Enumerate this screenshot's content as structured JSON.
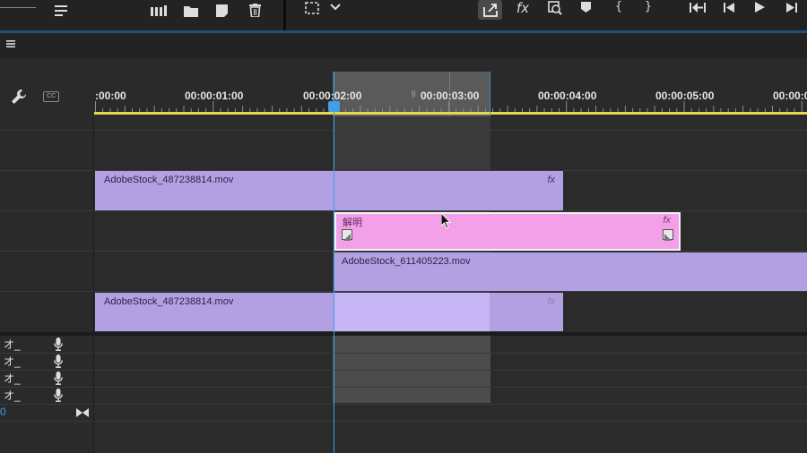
{
  "timecodes": [
    ":00:00",
    "00:00:01:00",
    "00:00:02:00",
    "00:00:03:00",
    "00:00:04:00",
    "00:00:05:00",
    "00:00:0"
  ],
  "clips": {
    "v4_name": "AdobeStock_487238814.mov",
    "transition_name": "解明",
    "v2_name": "AdobeStock_611405223.mov",
    "v1_name": "AdobeStock_487238814.mov",
    "fx_label": "fx"
  },
  "audio_tracks": [
    "オ_",
    "オ_",
    "オ_",
    "オ_"
  ],
  "master_value": "0",
  "colors": {
    "clip_purple": "#b3a0e3",
    "transition_pink": "#f3a0e8",
    "playhead_blue": "#3ea0e6",
    "work_area_yellow": "#e5d84c"
  },
  "icons": {
    "wrench": "wrench-icon",
    "captions": "captions-icon",
    "mic": "microphone-icon",
    "trash": "trash-icon",
    "folder": "folder-icon",
    "export": "export-frame-icon",
    "fx": "fx-icon",
    "play": "play-icon"
  }
}
